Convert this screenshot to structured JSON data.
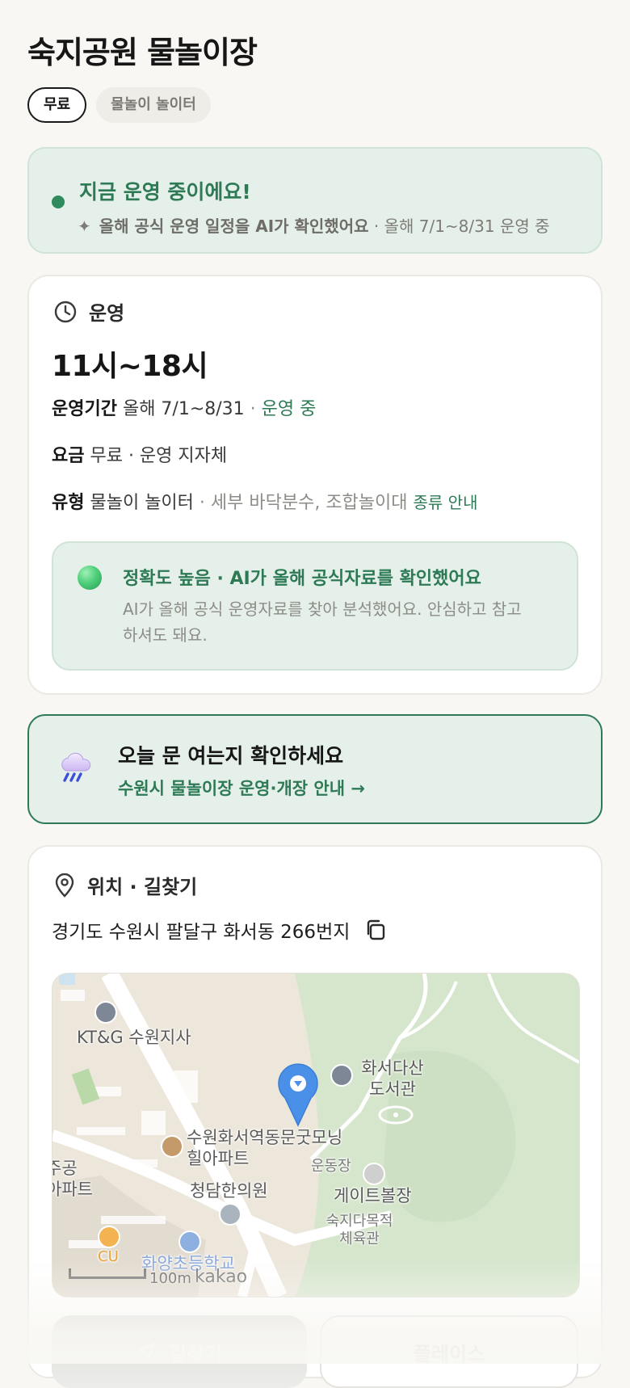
{
  "page": {
    "title": "숙지공원 물놀이장",
    "chips": {
      "free": "무료",
      "type": "물놀이 놀이터"
    }
  },
  "status": {
    "title": "지금 운영 중이에요!",
    "sub_bold": "올해 공식 운영 일정을 AI가 확인했어요",
    "sub_rest": " · 올해 7/1~8/31 운영 중",
    "dot_color": "#2f8a5e"
  },
  "ops": {
    "section_title": "운영",
    "hours": "11시~18시",
    "period": {
      "label": "운영기간",
      "value": " 올해 7/1~8/31",
      "sep": " · ",
      "state": "운영 중"
    },
    "fee": {
      "label": "요금",
      "value": " 무료 · 운영 지자체"
    },
    "type": {
      "label": "유형",
      "value": " 물놀이 놀이터",
      "detail": " · 세부 바닥분수, 조합놀이대 ",
      "link": "종류 안내"
    },
    "ai": {
      "title": "정확도 높음 · AI가 올해 공식자료를 확인했어요",
      "desc": "AI가 올해 공식 운영자료를 찾아 분석했어요. 안심하고 참고하셔도 돼요."
    }
  },
  "notice": {
    "title": "오늘 문 여는지 확인하세요",
    "link": "수원시 물놀이장 운영·개장 안내 →",
    "icon": "rain-cloud-icon"
  },
  "location": {
    "section_title": "위치 · 길찾기",
    "address": "경기도 수원시 팔달구 화서동 266번지",
    "map": {
      "labels": {
        "ktg": "KT&G 수원지사",
        "library": "화서다산 도서관",
        "apt": "수원화서역동문굿모닝 힐아파트",
        "field": "운동장",
        "gateball": "게이트볼장",
        "clinic": "청담한의원",
        "gym": "숙지다목적 체육관",
        "apt_left": "주공 아파트",
        "school": "화양초등학교",
        "cu": "CU"
      },
      "scale": "100m",
      "brand": "kakao",
      "pin_color": "#4a90e8"
    }
  },
  "actions": {
    "route": "길찾기",
    "place": "플레이스"
  }
}
